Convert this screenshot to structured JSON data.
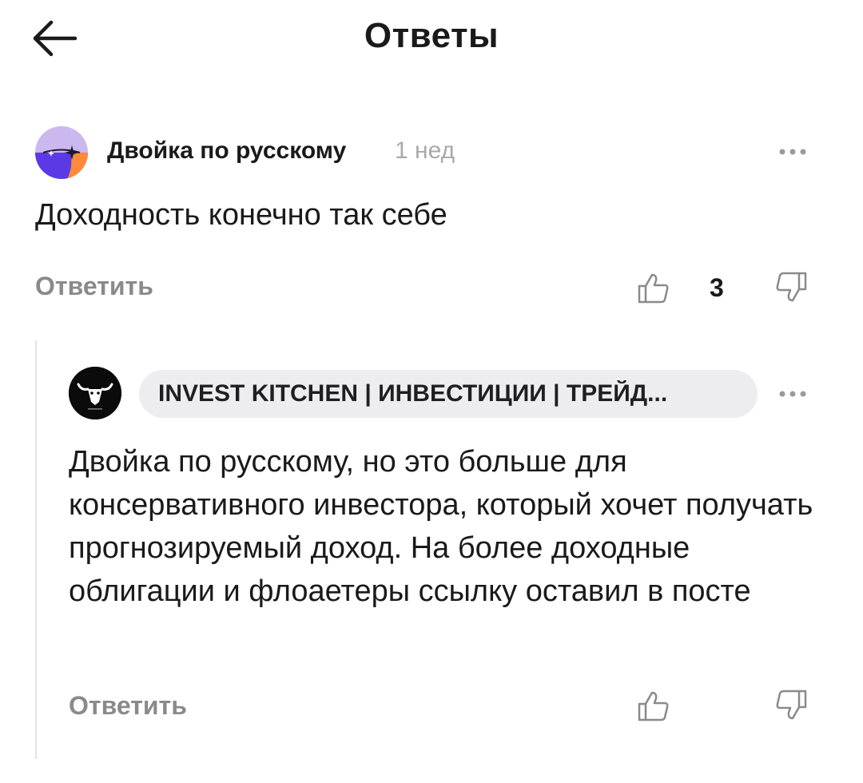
{
  "header": {
    "title": "Ответы",
    "back_icon": "arrow-left-icon"
  },
  "comment": {
    "author": "Двойка по русскому",
    "time": "1 нед",
    "text": "Доходность конечно так себе",
    "reply_label": "Ответить",
    "like_count": "3",
    "avatar_colors": [
      "#cbb8ee",
      "#5b3ae6",
      "#ff8a3a"
    ]
  },
  "reply": {
    "author": "INVEST KITCHEN | ИНВЕСТИЦИИ | ТРЕЙД...",
    "text": "Двойка по русскому, но это больше для консервативного инвестора, который хочет получать прогнозируемый доход. На более доходные облигации и флоаетеры ссылку оставил в посте",
    "reply_label": "Ответить",
    "avatar_icon": "bull-logo-icon"
  },
  "icons": {
    "more": "more-horizontal-icon",
    "like": "thumbs-up-icon",
    "dislike": "thumbs-down-icon"
  },
  "colors": {
    "muted": "#8a8a8a",
    "time": "#a9a9a9",
    "pill_bg": "#ededf0",
    "thread_line": "#e3e3e3"
  }
}
